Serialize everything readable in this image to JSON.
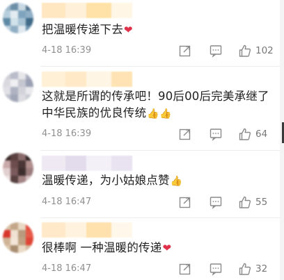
{
  "comments": [
    {
      "text": "把温暖传递下去",
      "suffix": "❤",
      "time": "4-18 16:39",
      "likes": "102",
      "avatar_colors": [
        "#9fb8c9",
        "#6d8fa8",
        "#c9d9e3",
        "#4d6f8a",
        "#b7cfdd",
        "#e3ecf1",
        "#7fa3bd",
        "#8fb0c6",
        "#5f8aa6",
        "#d2e2ea",
        "#a8c3d4",
        "#3f6a88",
        "#c0d4e0",
        "#90aec3",
        "#dfe9ef",
        "#6b92ad"
      ],
      "name_colors": [
        "#ffe7c2",
        "#fff1d9",
        "#ffe2a8",
        "#fff6e6"
      ]
    },
    {
      "text": "这就是所谓的传承吧！90后00后完美承继了中华民族的优良传统",
      "suffix": "👍👍",
      "time": "4-18 16:39",
      "likes": "64",
      "avatar_colors": [
        "#cfcfd6",
        "#b9bcc9",
        "#e6e6ea",
        "#a7abba",
        "#d9d9df",
        "#f0f0f2",
        "#c4c6d0",
        "#9aa0b3",
        "#e0e0e6",
        "#b0b4c2",
        "#d2d3da",
        "#eaeaee",
        "#bfc2cd",
        "#a2a7b8",
        "#dcdce2",
        "#c9cbd3"
      ],
      "name_colors": [
        "#fff0d6",
        "#ffe9c7",
        "#fff5e4",
        "#ffe3b5"
      ]
    },
    {
      "text": "温暖传递，为小姑娘点赞",
      "suffix": "👍",
      "time": "4-18 16:47",
      "likes": "55",
      "avatar_colors": [
        "#3a2a2a",
        "#5b4040",
        "#8a6a6a",
        "#2e2222",
        "#c9a9a9",
        "#6d4d4d",
        "#4a3636",
        "#b08e8e",
        "#e2cfcf",
        "#7a5a5a",
        "#3e2e2e",
        "#9b7b7b",
        "#f0e4e4",
        "#584040",
        "#a48484",
        "#d6c0c0"
      ],
      "name_colors": [
        "#efe9f4",
        "#e3dced",
        "#f4f0f8",
        "#e9e2f1"
      ]
    },
    {
      "text": "很棒啊 一种温暖的传递",
      "suffix": "❤",
      "time": "4-18 16:47",
      "likes": "32",
      "avatar_colors": [
        "#d9c3a8",
        "#c4a78a",
        "#e8d8c4",
        "#e24a3a",
        "#d7362c",
        "#efe2d2",
        "#b89a7c",
        "#e65a48",
        "#cfb396",
        "#f1e6d8",
        "#c0a283",
        "#e04434",
        "#dcc6ab",
        "#a88d70",
        "#ead9c5",
        "#d2b89c"
      ],
      "name_colors": [
        "#ffe9c9",
        "#fff3df",
        "#ffe1ad",
        "#fff7ea"
      ]
    }
  ]
}
